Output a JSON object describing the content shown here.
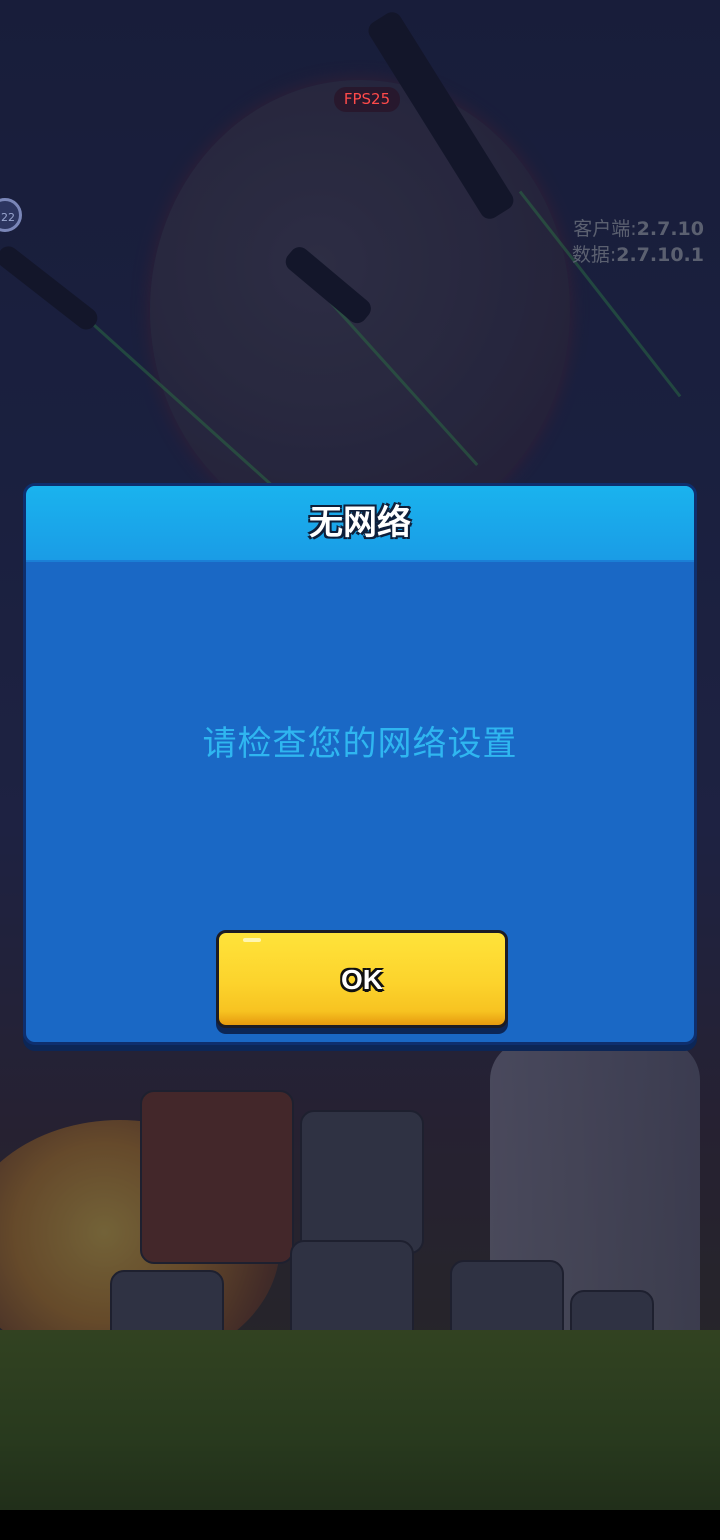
{
  "hud": {
    "fps_text": "FPS25",
    "avatar_badge": "22",
    "version": {
      "client_label": "客户端:",
      "client_value": "2.7.10",
      "data_label": "数据:",
      "data_value": "2.7.10.1"
    }
  },
  "dialog": {
    "title": "无网络",
    "message": "请检查您的网络设置",
    "ok_label": "OK"
  },
  "colors": {
    "dialog_body": "#1a68c5",
    "dialog_header": "#1ab3ee",
    "message_text": "#2fb6f0",
    "ok_button": "#fcd32c",
    "fps_text": "#ff4a4a"
  }
}
